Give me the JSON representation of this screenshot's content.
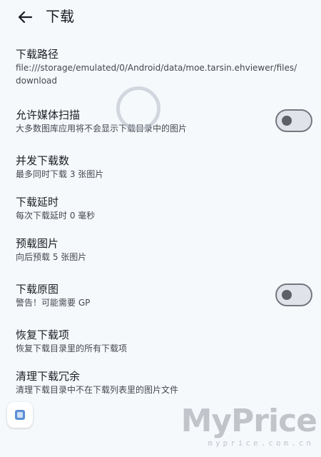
{
  "appbar": {
    "title": "下载",
    "back_icon": "arrow-left-icon"
  },
  "preferences": [
    {
      "title": "下载路径",
      "summary": "file:///storage/emulated/0/Android/data/moe.tarsin.ehviewer/files/download"
    },
    {
      "title": "允许媒体扫描",
      "summary": "大多数图库应用将不会显示下载目录中的图片",
      "switch": false
    },
    {
      "title": "并发下载数",
      "summary": "最多同时下载 3 张图片"
    },
    {
      "title": "下载延时",
      "summary": "每次下载延时 0 毫秒"
    },
    {
      "title": "预载图片",
      "summary": "向后预载 5 张图片"
    },
    {
      "title": "下载原图",
      "summary": "警告！可能需要 GP",
      "switch": false
    },
    {
      "title": "恢复下载项",
      "summary": "恢复下载目录里的所有下载项"
    },
    {
      "title": "清理下载冗余",
      "summary": "清理下载目录中不在下载列表里的图片文件"
    }
  ],
  "watermark": {
    "brand": "MyPrice",
    "domain": "myprice.com.cn"
  },
  "colors": {
    "background": "#f6f9fc",
    "switch_track": "#e1e3ea",
    "switch_outline": "#74777f"
  }
}
